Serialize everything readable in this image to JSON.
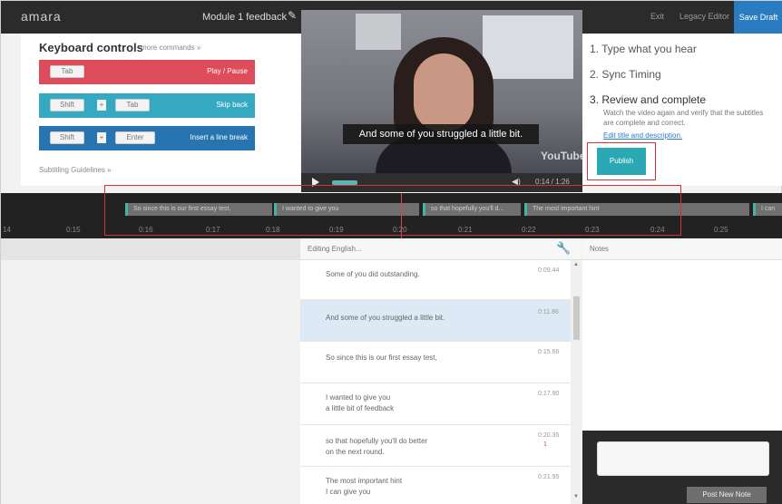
{
  "topbar": {
    "logo": "amara",
    "module_title": "Module 1 feedback",
    "exit": "Exit",
    "legacy_editor": "Legacy Editor",
    "save_draft": "Save Draft"
  },
  "keyboard": {
    "title": "Keyboard controls",
    "more": "more commands »",
    "rows": [
      {
        "keys": [
          "Tab"
        ],
        "action": "Play / Pause"
      },
      {
        "keys": [
          "Shift",
          "+",
          "Tab"
        ],
        "action": "Skip back"
      },
      {
        "keys": [
          "Shift",
          "+",
          "Enter"
        ],
        "action": "Insert a line break"
      }
    ],
    "guidelines": "Subtitling Guidelines »"
  },
  "video": {
    "caption": "And some of you struggled a little bit.",
    "brand": "YouTube",
    "time": "0:14 / 1:26"
  },
  "steps": {
    "step1": "1.  Type what you hear",
    "step2": "2.  Sync Timing",
    "step3": "3.  Review and complete",
    "desc": "Watch the video again and verify that the subtitles are complete and correct.",
    "edit_link": "Edit title and description.",
    "publish": "Publish"
  },
  "timeline": {
    "segments": [
      "So since this is our first essay test,",
      "I wanted to give you",
      "so that hopefully you'll d...",
      "The most important hint",
      "I can"
    ],
    "ticks": [
      "0:15",
      "0:16",
      "0:17",
      "0:18",
      "0:19",
      "0:20",
      "0:21",
      "0:22",
      "0:23",
      "0:24",
      "0:25"
    ]
  },
  "editing": {
    "header": "Editing English...",
    "rows": [
      {
        "text": [
          "Some of you did outstanding."
        ],
        "time": "0:09.44",
        "mark": ""
      },
      {
        "text": [
          "And some of you struggled a little bit."
        ],
        "time": "0:11.86",
        "mark": ""
      },
      {
        "text": [
          "So since this is our first essay test,"
        ],
        "time": "0:15.66",
        "mark": ""
      },
      {
        "text": [
          "I wanted to give you",
          "a little bit of feedback"
        ],
        "time": "0:17.90",
        "mark": ""
      },
      {
        "text": [
          "so that hopefully you'll do better",
          "on the next round."
        ],
        "time": "0:20.35",
        "mark": "1"
      },
      {
        "text": [
          "The most important hint",
          "I can give you"
        ],
        "time": "0:21.95",
        "mark": ""
      }
    ]
  },
  "notes": {
    "header": "Notes",
    "post": "Post New Note"
  }
}
